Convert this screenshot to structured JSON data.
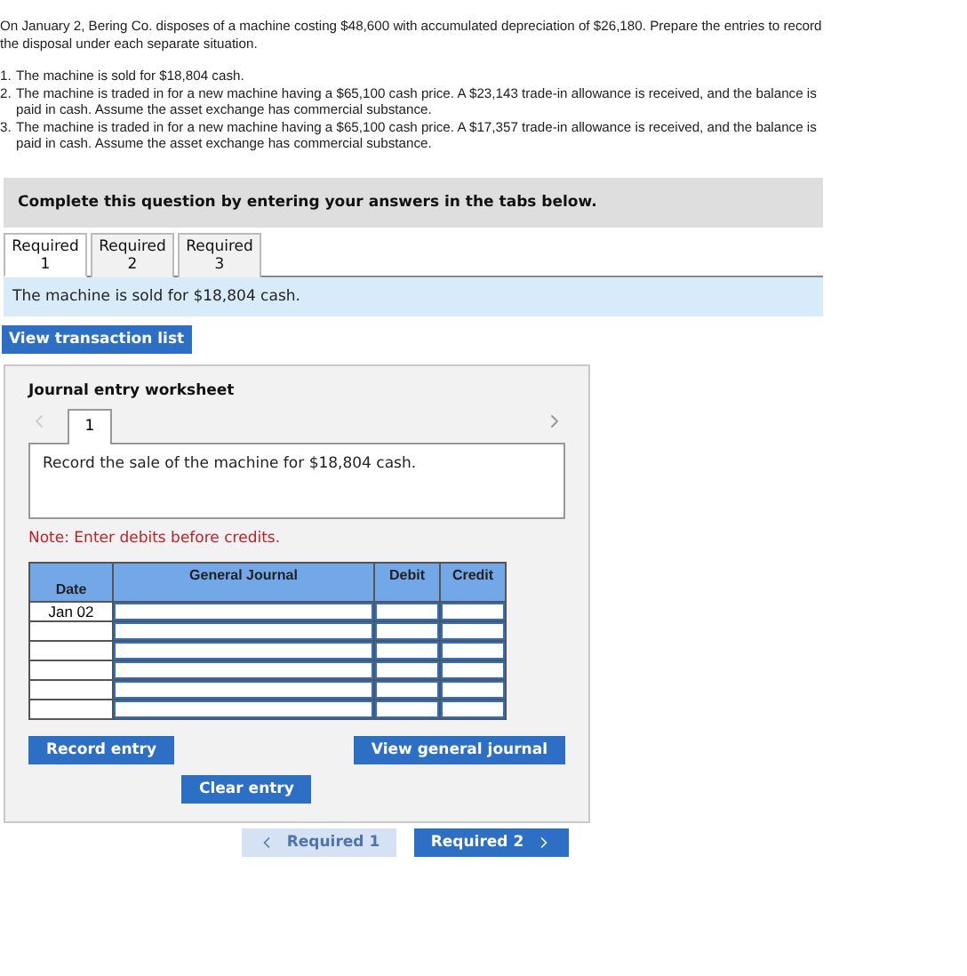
{
  "question": {
    "intro": "On January 2, Bering Co. disposes of a machine costing $48,600 with accumulated depreciation of $26,180. Prepare the entries to record the disposal under each separate situation.",
    "items": [
      {
        "number": "1.",
        "text": "The machine is sold for $18,804 cash."
      },
      {
        "number": "2.",
        "text": "The machine is traded in for a new machine having a $65,100 cash price. A $23,143 trade-in allowance is received, and the balance is paid in cash. Assume the asset exchange has commercial substance."
      },
      {
        "number": "3.",
        "text": "The machine is traded in for a new machine having a $65,100 cash price. A $17,357 trade-in allowance is received, and the balance is paid in cash. Assume the asset exchange has commercial substance."
      }
    ]
  },
  "instruction": "Complete this question by entering your answers in the tabs below.",
  "tabs": [
    {
      "label": "Required 1",
      "selected": true
    },
    {
      "label": "Required 2",
      "selected": false
    },
    {
      "label": "Required 3",
      "selected": false
    }
  ],
  "tab_banner": "The machine is sold for $18,804 cash.",
  "transaction_button": "View transaction list",
  "worksheet": {
    "title": "Journal entry worksheet",
    "prev_disabled": true,
    "pages": [
      {
        "label": "1",
        "selected": true
      }
    ],
    "prompt": "Record the sale of the machine for $18,804 cash.",
    "note": "Note: Enter debits before credits.",
    "columns": [
      "Date",
      "General Journal",
      "Debit",
      "Credit"
    ],
    "rows": [
      {
        "date": "Jan 02"
      },
      {},
      {},
      {},
      {},
      {}
    ],
    "record_button": "Record entry",
    "journal_button": "View general journal",
    "clear_button": "Clear entry"
  },
  "nav_back": {
    "label": "Required 1",
    "disabled": true
  },
  "nav_forward": {
    "label": "Required 2",
    "disabled": false
  }
}
